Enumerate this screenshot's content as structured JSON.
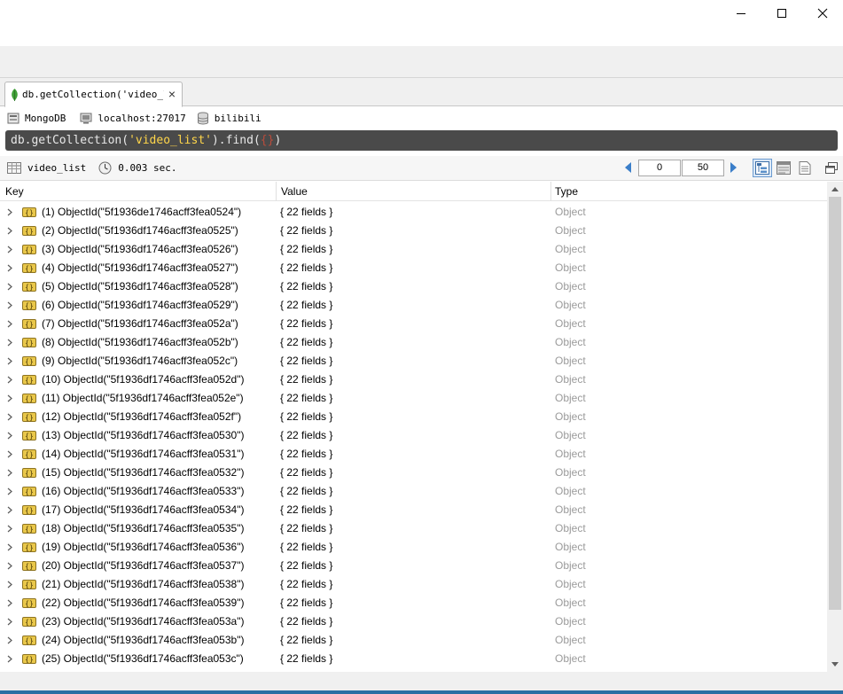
{
  "window": {
    "minimize_icon": "minimize-icon",
    "maximize_icon": "maximize-icon",
    "close_icon": "close-icon"
  },
  "tab": {
    "label": "db.getCollection('video_l…",
    "close": "×",
    "icon": "mongodb-leaf-icon"
  },
  "info": {
    "connection": "MongoDB",
    "server": "localhost:27017",
    "database": "bilibili"
  },
  "query": {
    "prefix": "db.getCollection(",
    "collection_arg": "'video_list'",
    "middle": ").find(",
    "braces": "{}",
    "suffix": ")"
  },
  "results_toolbar": {
    "collection": "video_list",
    "time": "0.003 sec.",
    "skip": "0",
    "limit": "50"
  },
  "grid": {
    "columns": {
      "key": "Key",
      "value": "Value",
      "type": "Type"
    },
    "rows": [
      {
        "key": "(1) ObjectId(\"5f1936de1746acff3fea0524\")",
        "value": "{ 22 fields }",
        "type": "Object"
      },
      {
        "key": "(2) ObjectId(\"5f1936df1746acff3fea0525\")",
        "value": "{ 22 fields }",
        "type": "Object"
      },
      {
        "key": "(3) ObjectId(\"5f1936df1746acff3fea0526\")",
        "value": "{ 22 fields }",
        "type": "Object"
      },
      {
        "key": "(4) ObjectId(\"5f1936df1746acff3fea0527\")",
        "value": "{ 22 fields }",
        "type": "Object"
      },
      {
        "key": "(5) ObjectId(\"5f1936df1746acff3fea0528\")",
        "value": "{ 22 fields }",
        "type": "Object"
      },
      {
        "key": "(6) ObjectId(\"5f1936df1746acff3fea0529\")",
        "value": "{ 22 fields }",
        "type": "Object"
      },
      {
        "key": "(7) ObjectId(\"5f1936df1746acff3fea052a\")",
        "value": "{ 22 fields }",
        "type": "Object"
      },
      {
        "key": "(8) ObjectId(\"5f1936df1746acff3fea052b\")",
        "value": "{ 22 fields }",
        "type": "Object"
      },
      {
        "key": "(9) ObjectId(\"5f1936df1746acff3fea052c\")",
        "value": "{ 22 fields }",
        "type": "Object"
      },
      {
        "key": "(10) ObjectId(\"5f1936df1746acff3fea052d\")",
        "value": "{ 22 fields }",
        "type": "Object"
      },
      {
        "key": "(11) ObjectId(\"5f1936df1746acff3fea052e\")",
        "value": "{ 22 fields }",
        "type": "Object"
      },
      {
        "key": "(12) ObjectId(\"5f1936df1746acff3fea052f\")",
        "value": "{ 22 fields }",
        "type": "Object"
      },
      {
        "key": "(13) ObjectId(\"5f1936df1746acff3fea0530\")",
        "value": "{ 22 fields }",
        "type": "Object"
      },
      {
        "key": "(14) ObjectId(\"5f1936df1746acff3fea0531\")",
        "value": "{ 22 fields }",
        "type": "Object"
      },
      {
        "key": "(15) ObjectId(\"5f1936df1746acff3fea0532\")",
        "value": "{ 22 fields }",
        "type": "Object"
      },
      {
        "key": "(16) ObjectId(\"5f1936df1746acff3fea0533\")",
        "value": "{ 22 fields }",
        "type": "Object"
      },
      {
        "key": "(17) ObjectId(\"5f1936df1746acff3fea0534\")",
        "value": "{ 22 fields }",
        "type": "Object"
      },
      {
        "key": "(18) ObjectId(\"5f1936df1746acff3fea0535\")",
        "value": "{ 22 fields }",
        "type": "Object"
      },
      {
        "key": "(19) ObjectId(\"5f1936df1746acff3fea0536\")",
        "value": "{ 22 fields }",
        "type": "Object"
      },
      {
        "key": "(20) ObjectId(\"5f1936df1746acff3fea0537\")",
        "value": "{ 22 fields }",
        "type": "Object"
      },
      {
        "key": "(21) ObjectId(\"5f1936df1746acff3fea0538\")",
        "value": "{ 22 fields }",
        "type": "Object"
      },
      {
        "key": "(22) ObjectId(\"5f1936df1746acff3fea0539\")",
        "value": "{ 22 fields }",
        "type": "Object"
      },
      {
        "key": "(23) ObjectId(\"5f1936df1746acff3fea053a\")",
        "value": "{ 22 fields }",
        "type": "Object"
      },
      {
        "key": "(24) ObjectId(\"5f1936df1746acff3fea053b\")",
        "value": "{ 22 fields }",
        "type": "Object"
      },
      {
        "key": "(25) ObjectId(\"5f1936df1746acff3fea053c\")",
        "value": "{ 22 fields }",
        "type": "Object"
      }
    ]
  },
  "colors": {
    "query_bg": "#4a4a4a",
    "query_string": "#ffd64a",
    "query_brace": "#b94c3c",
    "type_text": "#9a9a9a",
    "accent_blue": "#2b6ea3"
  }
}
